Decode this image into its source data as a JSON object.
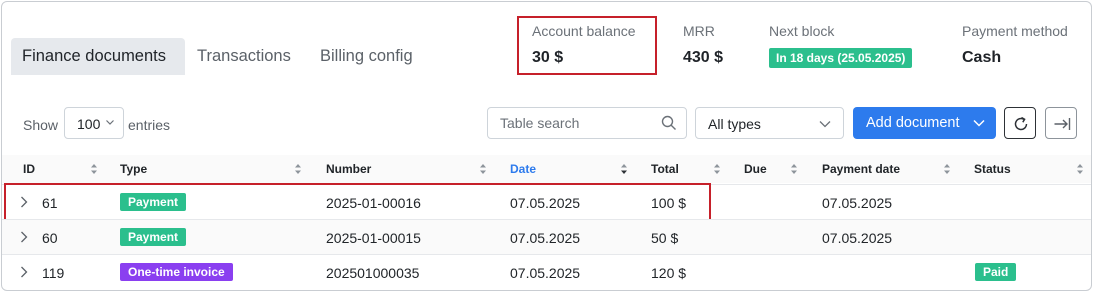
{
  "tabs": [
    {
      "label": "Finance documents",
      "active": true
    },
    {
      "label": "Transactions",
      "active": false
    },
    {
      "label": "Billing config",
      "active": false
    }
  ],
  "stats": {
    "account_balance": {
      "label": "Account balance",
      "value": "30 $"
    },
    "mrr": {
      "label": "MRR",
      "value": "430 $"
    },
    "next_block": {
      "label": "Next block",
      "value": "In 18 days (25.05.2025)"
    },
    "payment_method": {
      "label": "Payment method",
      "value": "Cash"
    }
  },
  "controls": {
    "show_label": "Show",
    "entries_value": "100",
    "entries_label": "entries",
    "search_placeholder": "Table search",
    "type_filter": "All types",
    "add_document_label": "Add document"
  },
  "table": {
    "columns": [
      {
        "key": "id",
        "label": "ID",
        "sorted": false
      },
      {
        "key": "type",
        "label": "Type",
        "sorted": false
      },
      {
        "key": "number",
        "label": "Number",
        "sorted": false
      },
      {
        "key": "date",
        "label": "Date",
        "sorted": true
      },
      {
        "key": "total",
        "label": "Total",
        "sorted": false
      },
      {
        "key": "due",
        "label": "Due",
        "sorted": false
      },
      {
        "key": "payment_date",
        "label": "Payment date",
        "sorted": false
      },
      {
        "key": "status",
        "label": "Status",
        "sorted": false
      }
    ],
    "rows": [
      {
        "id": "61",
        "type": "Payment",
        "number": "2025-01-00016",
        "date": "07.05.2025",
        "total": "100 $",
        "due": "",
        "payment_date": "07.05.2025",
        "status": ""
      },
      {
        "id": "60",
        "type": "Payment",
        "number": "2025-01-00015",
        "date": "07.05.2025",
        "total": "50 $",
        "due": "",
        "payment_date": "07.05.2025",
        "status": ""
      },
      {
        "id": "119",
        "type": "One-time invoice",
        "number": "202501000035",
        "date": "07.05.2025",
        "total": "120 $",
        "due": "",
        "payment_date": "",
        "status": "Paid"
      }
    ]
  },
  "colors": {
    "accent": "#2d7bed",
    "badge_payment": "#2bbf8d",
    "badge_invoice": "#8a3ff0",
    "badge_paid": "#2bbf8d",
    "highlight": "#c6202a"
  }
}
